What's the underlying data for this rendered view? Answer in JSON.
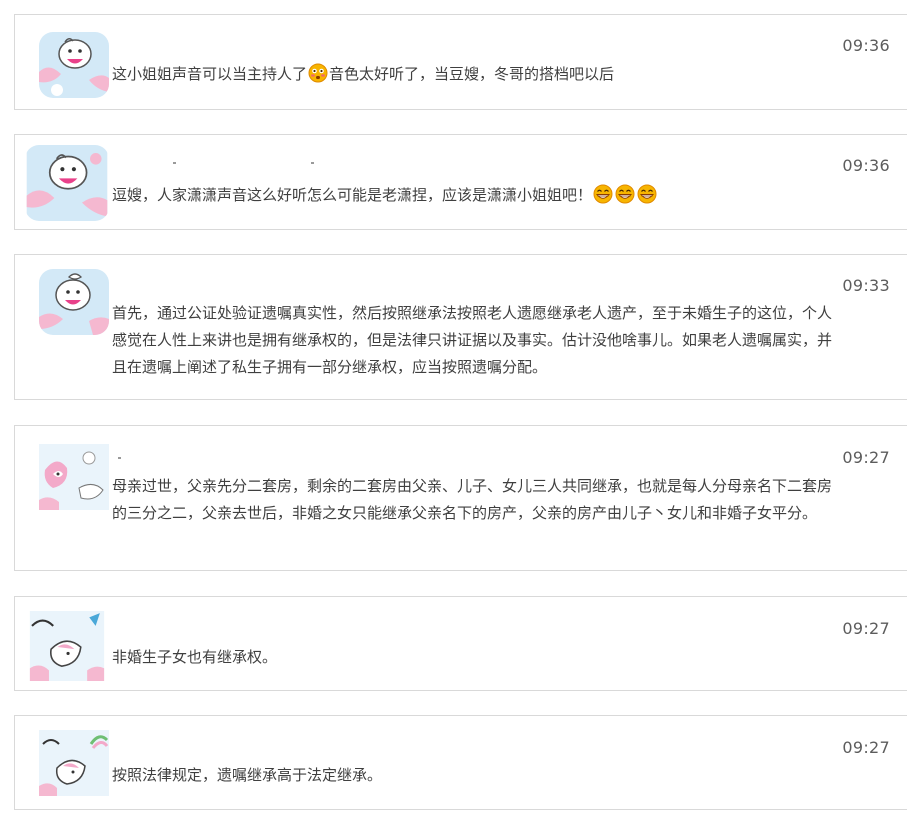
{
  "comments": [
    {
      "time": "09:36",
      "part1": "这小姐姐声音可以当主持人了",
      "part2": "音色太好听了，当豆嫂，冬哥的搭档吧以后",
      "avatar_icon": "cartoon-pig-avatar",
      "emoji_icon": "flushed-face-emoji"
    },
    {
      "time": "09:36",
      "part1": "逗嫂，人家潇潇声音这么好听怎么可能是老潇捏，应该是潇潇小姐姐吧！",
      "avatar_icon": "cartoon-pig-avatar",
      "emoji_icon": "grinning-face-emoji"
    },
    {
      "time": "09:33",
      "text": "首先，通过公证处验证遗嘱真实性，然后按照继承法按照老人遗愿继承老人遗产，至于未婚生子的这位，个人感觉在人性上来讲也是拥有继承权的，但是法律只讲证据以及事实。估计没他啥事儿。如果老人遗嘱属实，并且在遗嘱上阐述了私生子拥有一部分继承权，应当按照遗嘱分配。",
      "avatar_icon": "cartoon-pig-avatar"
    },
    {
      "time": "09:27",
      "text": "母亲过世，父亲先分二套房，剩余的二套房由父亲、儿子、女儿三人共同继承，也就是每人分母亲名下二套房的三分之二，父亲去世后，非婚之女只能继承父亲名下的房产，父亲的房产由儿子丶女儿和非婚子女平分。",
      "avatar_icon": "cartoon-unicorn-avatar"
    },
    {
      "time": "09:27",
      "text": "非婚生子女也有继承权。",
      "avatar_icon": "cartoon-unicorn-avatar"
    },
    {
      "time": "09:27",
      "text": "按照法律规定，遗嘱继承高于法定继承。",
      "avatar_icon": "cartoon-unicorn-avatar"
    }
  ],
  "colors": {
    "border": "#d9d9d9",
    "text": "#3f3f3f",
    "time": "#5c5c5c",
    "avatar_bg": "#cfe6f5",
    "avatar_pink": "#f3a9c9",
    "emoji_yellow": "#f7c948"
  }
}
